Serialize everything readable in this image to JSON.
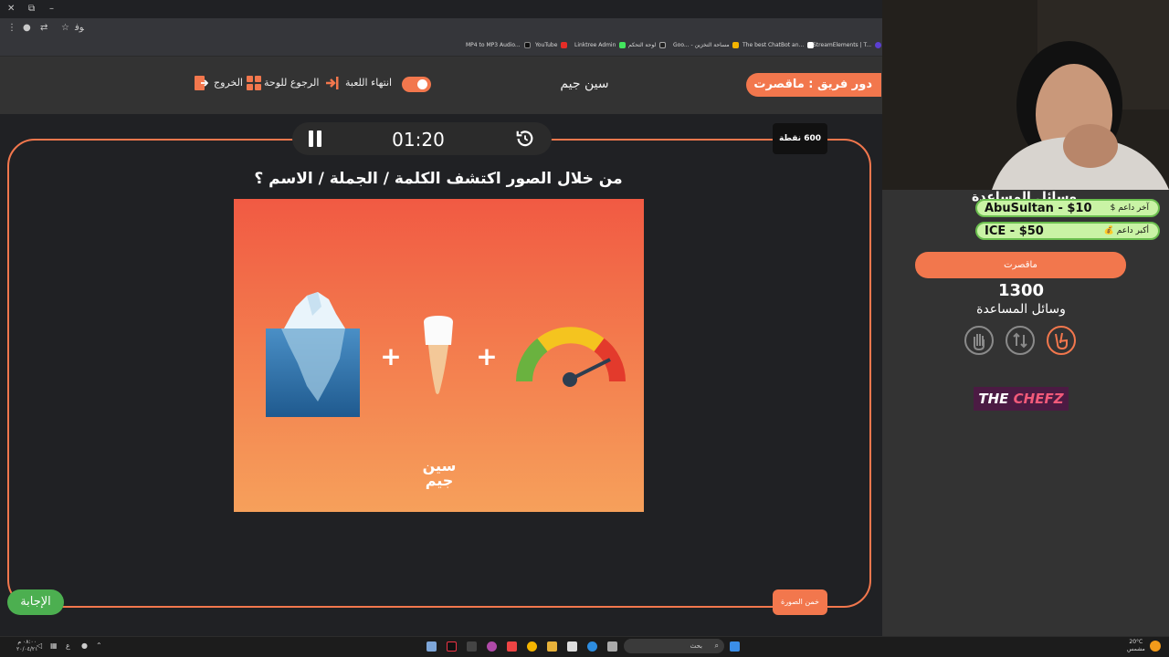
{
  "browser": {
    "address": "ﻮﻓ",
    "bookmarks": [
      "MP4 to MP3 Audio...",
      "YouTube",
      "Linktree Admin",
      "لوحة التحكم",
      "Goo... - مساحة التخزين",
      "The best ChatBot an...",
      "StreamElements | T..."
    ]
  },
  "header": {
    "turn_label": "دور فريق : ماقصرت",
    "game_name": "سين جيم",
    "end_game": "انتهاء اللعبة",
    "back_to_board": "الرجوع للوحة",
    "exit": "الخروج"
  },
  "game": {
    "timer": "01:20",
    "points": "600 نقطة",
    "question": "من خلال الصور اكتشف الكلمة / الجملة / الاسم ؟",
    "guess_button": "خمن الصورة",
    "answer_button": "الإجابة",
    "watermark": "سين جيم"
  },
  "right_panel": {
    "aids_title_top": "وسائل المساعدة",
    "donors": [
      {
        "label": "آخر داعم $",
        "value": "AbuSultan - $10"
      },
      {
        "label": "أكبر داعم 💰",
        "value": "ICE - $50"
      }
    ],
    "team_name": "ماقصرت",
    "score": "1300",
    "aids_title": "وسائل المساعدة",
    "aids": [
      {
        "icon": "hand-stop-icon",
        "active": false
      },
      {
        "icon": "swap-icon",
        "active": false
      },
      {
        "icon": "peace-hand-icon",
        "active": true
      }
    ],
    "sponsor": {
      "part1": "THE ",
      "part2": "CHEFZ"
    }
  },
  "taskbar": {
    "search": "بحث",
    "clock_line1": "٠٨:٠٠ م",
    "clock_line2": "٢٠/٠٤/٢١",
    "lang": "ع",
    "weather_line1": "20°C",
    "weather_line2": "مشمس"
  },
  "colors": {
    "accent": "#f2774d",
    "answer_green": "#4caf50",
    "donor_bg": "#c9f3a5",
    "background": "#333333"
  }
}
